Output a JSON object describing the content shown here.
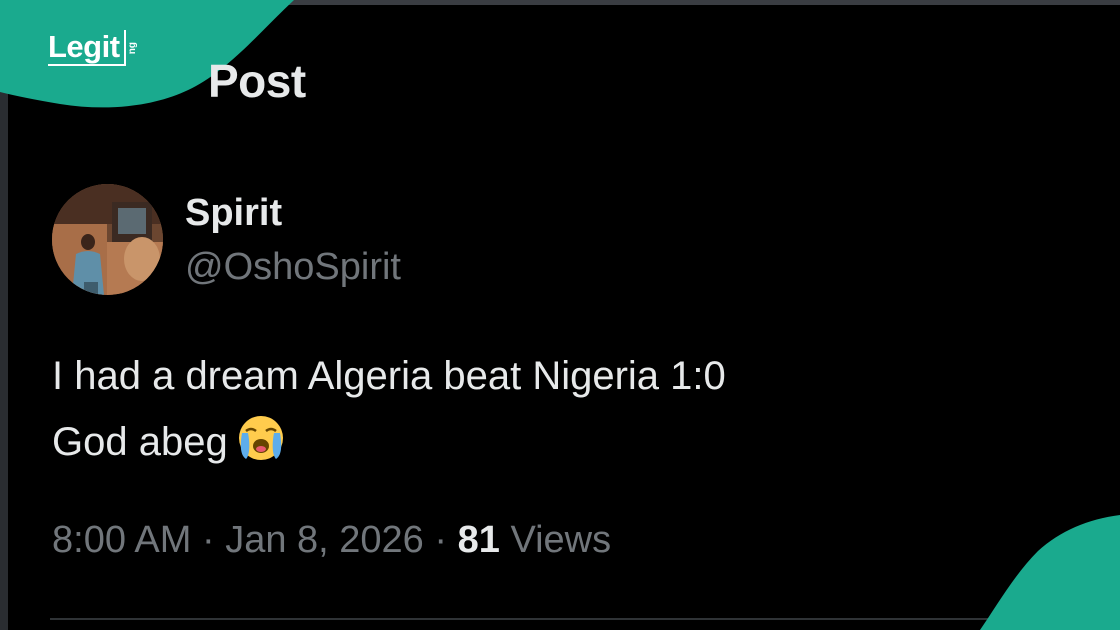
{
  "brand": {
    "logo_text": "Legit",
    "logo_tld": "ng",
    "color": "#1aaa8e"
  },
  "header": {
    "title": "Post"
  },
  "post": {
    "author": {
      "display_name": "Spirit",
      "handle": "@OshoSpirit"
    },
    "text_lines": [
      "I had a dream Algeria beat Nigeria 1:0",
      "God abeg"
    ],
    "emoji": "loudly-crying-face-icon",
    "time": "8:00 AM",
    "date": "Jan 8, 2026",
    "separator": "·",
    "views_count": "81",
    "views_label": "Views"
  },
  "colors": {
    "background": "#000000",
    "primary_text": "#e7e9ea",
    "secondary_text": "#71767b"
  }
}
